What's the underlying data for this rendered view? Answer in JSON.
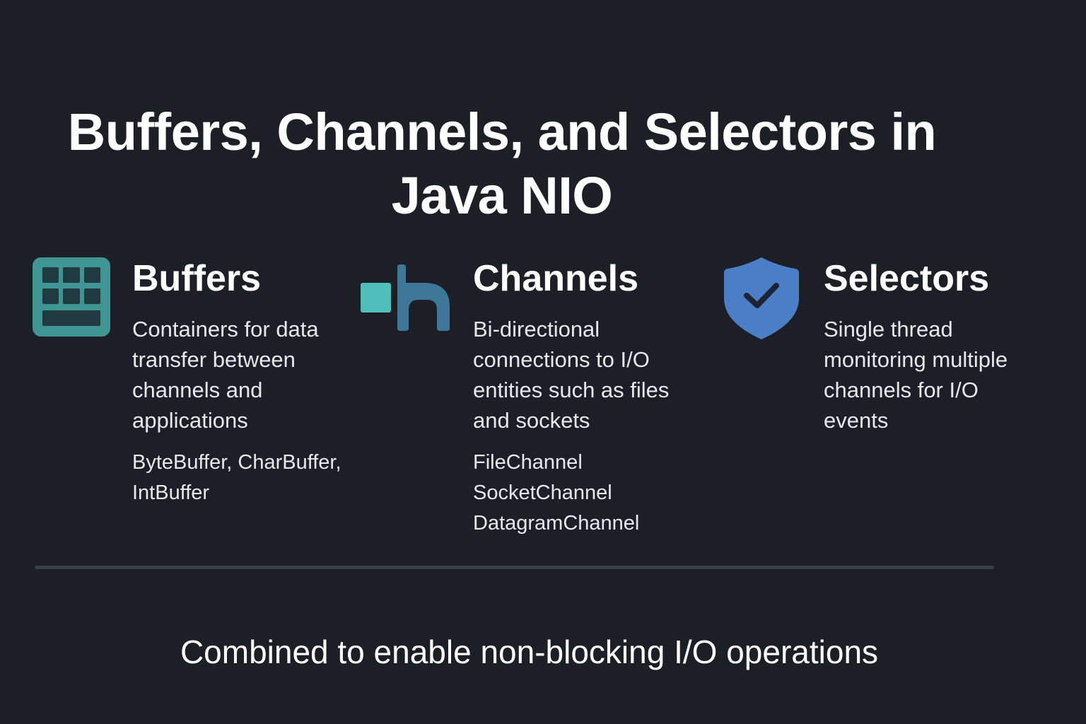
{
  "title": "Buffers, Channels, and Selectors in Java NIO",
  "sections": [
    {
      "heading": "Buffers",
      "icon": "grid-buffer-icon",
      "description": "Containers for data transfer between channels and applications",
      "examples": [
        "ByteBuffer, CharBuffer,",
        "IntBuffer"
      ]
    },
    {
      "heading": "Channels",
      "icon": "channel-connector-icon",
      "description": "Bi-directional connections to I/O entities such as files and sockets",
      "examples": [
        "FileChannel",
        "SocketChannel",
        "DatagramChannel"
      ]
    },
    {
      "heading": "Selectors",
      "icon": "shield-check-icon",
      "description": "Single thread monitoring multiple channels for I/O events"
    }
  ],
  "footer": "Combined to enable non-blocking I/O operations",
  "colors": {
    "background": "#1c1f25",
    "buffer_icon": "#3f9591",
    "channel_accent": "#4fbfbb",
    "channel_main": "#3e7898",
    "selector_shield": "#4a7fc8",
    "divider": "#3a3e47"
  }
}
